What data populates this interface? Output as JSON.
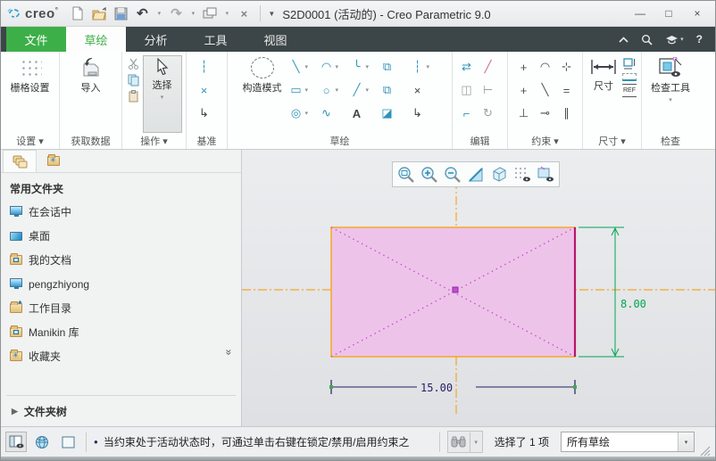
{
  "titlebar": {
    "logo_text": "creo",
    "title": "S2D0001 (活动的) - Creo Parametric 9.0"
  },
  "ribbon_tabs": {
    "file": "文件",
    "sketch": "草绘",
    "analysis": "分析",
    "tools": "工具",
    "view": "视图"
  },
  "ribbon": {
    "settings": {
      "grid_button": "栅格设置",
      "group_label": "设置 ▾"
    },
    "get_data": {
      "import_button": "导入",
      "group_label": "获取数据"
    },
    "operations": {
      "select_button": "选择",
      "group_label": "操作 ▾"
    },
    "datum": {
      "group_label": "基准"
    },
    "sketch": {
      "construction_button": "构造模式",
      "group_label": "草绘"
    },
    "edit": {
      "group_label": "编辑"
    },
    "constrain": {
      "group_label": "约束 ▾"
    },
    "dimension": {
      "dim_button": "尺寸",
      "group_label": "尺寸 ▾"
    },
    "inspect": {
      "inspect_button": "检查工具",
      "group_label": "检查"
    }
  },
  "navigator": {
    "section_title": "常用文件夹",
    "items": [
      {
        "label": "在会话中"
      },
      {
        "label": "桌面"
      },
      {
        "label": "我的文档"
      },
      {
        "label": "pengzhiyong"
      },
      {
        "label": "工作目录"
      },
      {
        "label": "Manikin 库"
      },
      {
        "label": "收藏夹"
      }
    ],
    "folder_tree": "文件夹树"
  },
  "canvas": {
    "dim_height": "8.00",
    "dim_width": "15.00"
  },
  "statusbar": {
    "message": "当约束处于活动状态时，可通过单击右键在锁定/禁用/启用约束之",
    "selection_count": "选择了 1 项",
    "filter_dropdown": "所有草绘"
  },
  "glyphs": {
    "dropdown": "▾",
    "window_dropdown": "▼",
    "minimize": "—",
    "maximize": "□",
    "close": "×",
    "undo": "↶",
    "redo": "↷",
    "close_window": "×",
    "help": "?",
    "datum": [
      "┆",
      "×",
      "↳"
    ],
    "sketch_tools": [
      "╲",
      "◠",
      "╰",
      "⧉",
      "┆",
      "▭",
      "○",
      "╱",
      "⧉",
      "×",
      "◎",
      "∿",
      "A",
      "◪",
      "↳"
    ],
    "edit_tools": [
      "⇄",
      "╱",
      "◫",
      "⊢",
      "⌐",
      "↻"
    ],
    "constraints": [
      "+",
      "◠",
      "⊹",
      "+",
      "╲",
      "=",
      "⊥",
      "⊸",
      "∥"
    ],
    "dim_ref": "REF",
    "chevron_double_down": "»",
    "tree_expand": "▶",
    "bullet": "●"
  },
  "colors": {
    "accent_green": "#3daf49",
    "tab_bar_dark": "#3c4547",
    "centerline_orange": "#f7a727",
    "construction_magenta": "#c24fd0",
    "dim_green": "#00a650",
    "dim_navy": "#2a1a66",
    "rect_fill_pink": "#eec3e9",
    "selected_edge_crimson": "#b5186b"
  }
}
